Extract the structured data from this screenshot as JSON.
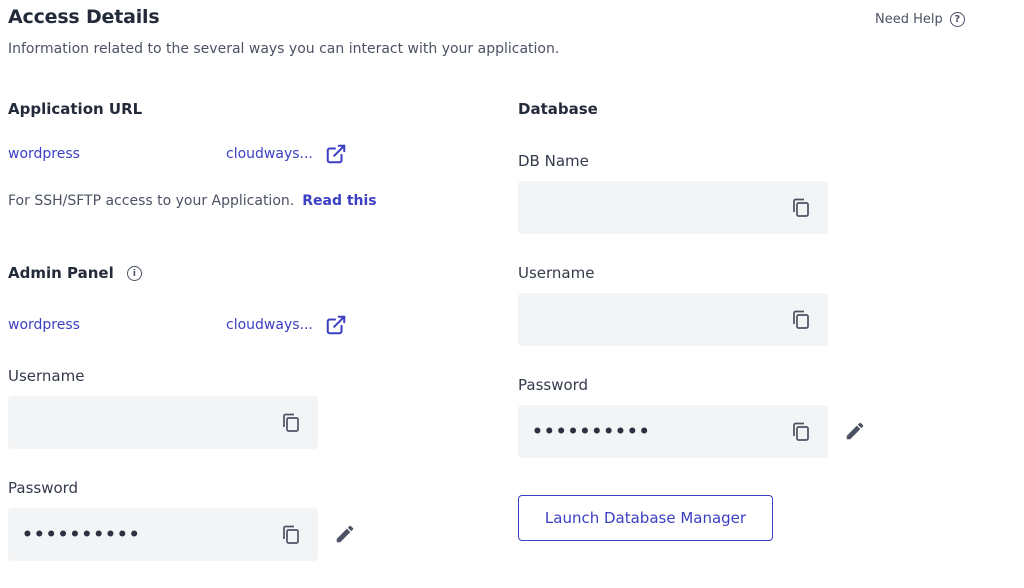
{
  "header": {
    "title": "Access Details",
    "subtitle": "Information related to the several ways you can interact with your application.",
    "help_label": "Need Help"
  },
  "application_url": {
    "heading": "Application URL",
    "url_left": "wordpress",
    "url_right": "cloudways...",
    "note_text": "For SSH/SFTP access to your Application.",
    "note_link": "Read this"
  },
  "admin_panel": {
    "heading": "Admin Panel",
    "url_left": "wordpress",
    "url_right": "cloudways...",
    "username_label": "Username",
    "username_value": "",
    "password_label": "Password",
    "password_value": "••••••••••"
  },
  "database": {
    "heading": "Database",
    "db_name_label": "DB Name",
    "db_name_value": "",
    "username_label": "Username",
    "username_value": "",
    "password_label": "Password",
    "password_value": "••••••••••",
    "launch_button": "Launch Database Manager"
  },
  "colors": {
    "accent": "#3b3fc2",
    "field_bg": "#f3f4f6",
    "text": "#2e3545"
  },
  "icons": [
    "help-circle-icon",
    "external-link-icon",
    "info-icon",
    "copy-icon",
    "edit-pencil-icon"
  ]
}
